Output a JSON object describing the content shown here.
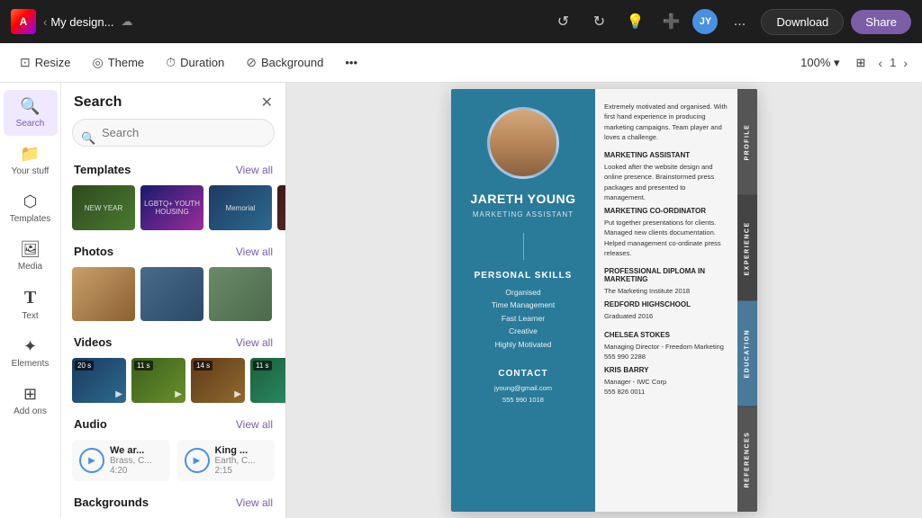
{
  "topbar": {
    "logo": "A",
    "filename": "My design...",
    "download_label": "Download",
    "share_label": "Share",
    "more_label": "...",
    "zoom_level": "100%",
    "page_number": "1"
  },
  "toolbar": {
    "resize_label": "Resize",
    "theme_label": "Theme",
    "duration_label": "Duration",
    "background_label": "Background"
  },
  "sidebar": {
    "items": [
      {
        "id": "search",
        "label": "Search",
        "icon": "🔍"
      },
      {
        "id": "yourstuff",
        "label": "Your stuff",
        "icon": "📁"
      },
      {
        "id": "templates",
        "label": "Templates",
        "icon": "⬡"
      },
      {
        "id": "media",
        "label": "Media",
        "icon": "🖼"
      },
      {
        "id": "text",
        "label": "Text",
        "icon": "T"
      },
      {
        "id": "elements",
        "label": "Elements",
        "icon": "✦"
      },
      {
        "id": "addons",
        "label": "Add ons",
        "icon": "⊞"
      }
    ]
  },
  "search_panel": {
    "title": "Search",
    "search_placeholder": "Search",
    "sections": {
      "templates": {
        "title": "Templates",
        "view_all": "View all"
      },
      "photos": {
        "title": "Photos",
        "view_all": "View all"
      },
      "videos": {
        "title": "Videos",
        "view_all": "View all"
      },
      "audio": {
        "title": "Audio",
        "view_all": "View all",
        "items": [
          {
            "title": "We ar...",
            "sub": "Brass, C...",
            "duration": "4:20"
          },
          {
            "title": "King ...",
            "sub": "Earth, C...",
            "duration": "2:15"
          }
        ]
      },
      "backgrounds": {
        "title": "Backgrounds",
        "view_all": "View all"
      }
    },
    "videos": [
      {
        "duration": "20 s"
      },
      {
        "duration": "11 s"
      },
      {
        "duration": "14 s"
      },
      {
        "duration": "11 s"
      },
      {
        "duration": ""
      }
    ]
  },
  "resume": {
    "name": "JARETH YOUNG",
    "title": "MARKETING ASSISTANT",
    "profile_text": "Extremely motivated and organised. With first hand experience in producing marketing campaigns. Team player and loves a challenge.",
    "sections": {
      "experience": {
        "title": "EXPERIENCE",
        "jobs": [
          {
            "title": "MARKETING ASSISTANT",
            "description": "Looked after the website design and online presence. Brainstormed press packages and presented to management."
          },
          {
            "title": "MARKETING CO-ORDINATOR",
            "description": "Put together presentations for clients. Managed new clients documentation. Helped management co-ordinate press releases."
          }
        ]
      },
      "education": {
        "title": "EDUCATION",
        "entries": [
          {
            "title": "PROFESSIONAL DIPLOMA IN MARKETING",
            "sub": "The Marketing Institute 2018"
          },
          {
            "title": "REDFORD HIGHSCHOOL",
            "sub": "Graduated 2016"
          }
        ]
      },
      "references": {
        "title": "REFERENCES",
        "entries": [
          {
            "name": "Chelsea Stokes",
            "role": "Managing Director - Freedom Marketing",
            "phone": "555 990 2288"
          },
          {
            "name": "Kris Barry",
            "role": "Manager - IWC Corp",
            "phone": "555 826 0011"
          }
        ]
      },
      "skills": {
        "title": "PERSONAL SKILLS",
        "items": [
          "Organised",
          "Time Management",
          "Fast Learner",
          "Creative",
          "Highly Motivated"
        ]
      },
      "contact": {
        "title": "CONTACT",
        "email": "jyoung@gmail.com",
        "phone": "555 990 1018"
      }
    },
    "tab_labels": [
      "PROFILE",
      "EXPERIENCE",
      "EDUCATION",
      "REFERENCES"
    ]
  }
}
